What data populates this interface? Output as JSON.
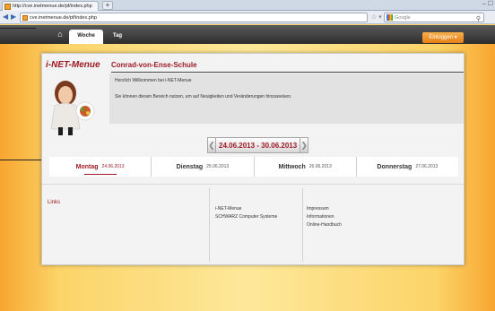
{
  "browser": {
    "tab_title": "http://cve.inetmenue.de/pf/index.php",
    "new_tab": "+",
    "window_controls": "– ☐",
    "back": "◀",
    "forward": "▶",
    "url": "cve.inetmenue.de/pf/index.php",
    "url_icons": "☆ ▾ C",
    "search_placeholder": "Google",
    "search_icon": "magnifier-icon"
  },
  "app": {
    "home_icon": "home-icon",
    "tabs": [
      {
        "label": "Woche"
      },
      {
        "label": "Tag"
      }
    ],
    "login_label": "Einloggen ▾"
  },
  "header": {
    "brand": "i-NET-Menue",
    "school": "Conrad-von-Ense-Schule"
  },
  "info": {
    "welcome": "Herzlich Willkommen bei i-NET-Menue",
    "text": "Sie können diesen Bereich nutzen, um auf Neuigkeiten und Veränderungen hinzuweisen."
  },
  "week": {
    "prev": "❮",
    "label": "24.06.2013 - 30.06.2013",
    "next": "❯"
  },
  "days": [
    {
      "name": "Montag",
      "date": "24.06.2013"
    },
    {
      "name": "Dienstag",
      "date": "25.06.2013"
    },
    {
      "name": "Mittwoch",
      "date": "26.06.2013"
    },
    {
      "name": "Donnerstag",
      "date": "27.06.2013"
    }
  ],
  "footer": {
    "links_heading": "Links",
    "col1": [
      "i-NET-Menue",
      "SCHWARZ Computer Systeme"
    ],
    "col2": [
      "Impressum",
      "Informationen",
      "Online-Handbuch"
    ]
  },
  "colors": {
    "accent": "#9d1a24",
    "login": "#e57f18",
    "appbar": "#2d2d2d"
  }
}
